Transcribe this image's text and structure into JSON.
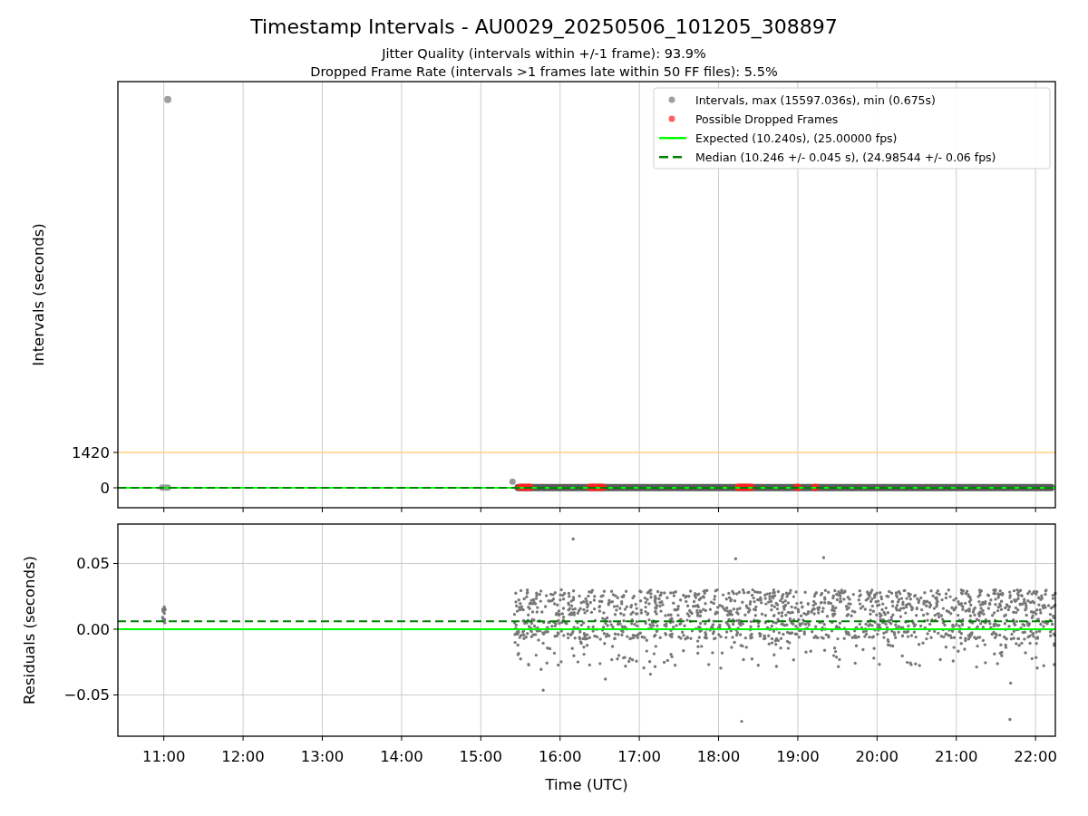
{
  "title": "Timestamp Intervals - AU0029_20250506_101205_308897",
  "subtitles": [
    "Jitter Quality (intervals within +/-1 frame): 93.9%",
    "Dropped Frame Rate (intervals >1 frames late within 50 FF files): 5.5%"
  ],
  "intervals_plot": {
    "chart_data": {
      "type": "scatter",
      "ylabel": "Intervals (seconds)",
      "xlim": [
        10.42,
        22.25
      ],
      "ylim": [
        -801,
        16312
      ],
      "yticks": [
        0,
        1420
      ],
      "grid": true,
      "ref_lines": [
        {
          "axis": "y",
          "value": 0,
          "color": "#00ff00"
        },
        {
          "axis": "y",
          "value": 0,
          "color": "#008000"
        },
        {
          "axis": "y",
          "value": 1420,
          "color": "#ffd27f"
        }
      ]
    },
    "legend": [
      {
        "kind": "dot",
        "color": "#a0a0a0",
        "label": "Intervals, max (15597.036s), min (0.675s)"
      },
      {
        "kind": "dot",
        "color": "#ff6060",
        "label": "Possible Dropped Frames"
      },
      {
        "kind": "line",
        "color": "#00ff00",
        "label": "Expected (10.240s), (25.00000 fps)"
      },
      {
        "kind": "dashed",
        "color": "#008000",
        "label": "Median (10.246 +/- 0.045 s), (24.98544 +/- 0.06 fps)"
      }
    ]
  },
  "residuals_plot": {
    "chart_data": {
      "type": "scatter",
      "xlabel": "Time (UTC)",
      "ylabel": "Residuals (seconds)",
      "xlim": [
        10.42,
        22.25
      ],
      "ylim": [
        -0.0814,
        0.08
      ],
      "xticks": [
        {
          "value": 11,
          "label": "11:00"
        },
        {
          "value": 12,
          "label": "12:00"
        },
        {
          "value": 13,
          "label": "13:00"
        },
        {
          "value": 14,
          "label": "14:00"
        },
        {
          "value": 15,
          "label": "15:00"
        },
        {
          "value": 16,
          "label": "16:00"
        },
        {
          "value": 17,
          "label": "17:00"
        },
        {
          "value": 18,
          "label": "18:00"
        },
        {
          "value": 19,
          "label": "19:00"
        },
        {
          "value": 20,
          "label": "20:00"
        },
        {
          "value": 21,
          "label": "21:00"
        },
        {
          "value": 22,
          "label": "22:00"
        }
      ],
      "yticks": [
        {
          "value": 0.05,
          "label": "0.05"
        },
        {
          "value": 0,
          "label": "0.00"
        },
        {
          "value": -0.05,
          "label": "−0.05"
        }
      ],
      "grid": true,
      "ref_lines": [
        {
          "axis": "y",
          "value": 0,
          "color": "#00ff00"
        },
        {
          "axis": "y",
          "value": 0.006,
          "color": "#008000"
        }
      ]
    }
  }
}
